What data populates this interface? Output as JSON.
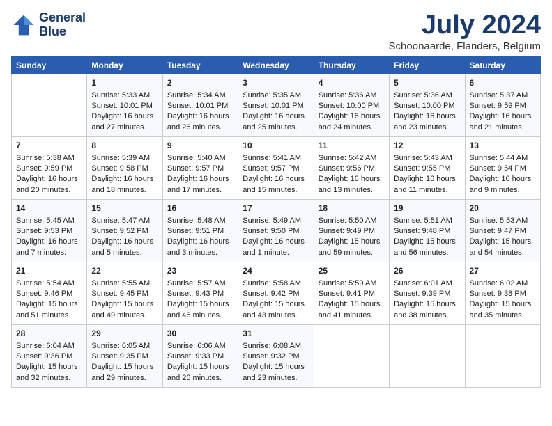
{
  "header": {
    "logo_line1": "General",
    "logo_line2": "Blue",
    "title": "July 2024",
    "location": "Schoonaarde, Flanders, Belgium"
  },
  "weekdays": [
    "Sunday",
    "Monday",
    "Tuesday",
    "Wednesday",
    "Thursday",
    "Friday",
    "Saturday"
  ],
  "weeks": [
    [
      {
        "day": "",
        "info": ""
      },
      {
        "day": "1",
        "info": "Sunrise: 5:33 AM\nSunset: 10:01 PM\nDaylight: 16 hours\nand 27 minutes."
      },
      {
        "day": "2",
        "info": "Sunrise: 5:34 AM\nSunset: 10:01 PM\nDaylight: 16 hours\nand 26 minutes."
      },
      {
        "day": "3",
        "info": "Sunrise: 5:35 AM\nSunset: 10:01 PM\nDaylight: 16 hours\nand 25 minutes."
      },
      {
        "day": "4",
        "info": "Sunrise: 5:36 AM\nSunset: 10:00 PM\nDaylight: 16 hours\nand 24 minutes."
      },
      {
        "day": "5",
        "info": "Sunrise: 5:36 AM\nSunset: 10:00 PM\nDaylight: 16 hours\nand 23 minutes."
      },
      {
        "day": "6",
        "info": "Sunrise: 5:37 AM\nSunset: 9:59 PM\nDaylight: 16 hours\nand 21 minutes."
      }
    ],
    [
      {
        "day": "7",
        "info": "Sunrise: 5:38 AM\nSunset: 9:59 PM\nDaylight: 16 hours\nand 20 minutes."
      },
      {
        "day": "8",
        "info": "Sunrise: 5:39 AM\nSunset: 9:58 PM\nDaylight: 16 hours\nand 18 minutes."
      },
      {
        "day": "9",
        "info": "Sunrise: 5:40 AM\nSunset: 9:57 PM\nDaylight: 16 hours\nand 17 minutes."
      },
      {
        "day": "10",
        "info": "Sunrise: 5:41 AM\nSunset: 9:57 PM\nDaylight: 16 hours\nand 15 minutes."
      },
      {
        "day": "11",
        "info": "Sunrise: 5:42 AM\nSunset: 9:56 PM\nDaylight: 16 hours\nand 13 minutes."
      },
      {
        "day": "12",
        "info": "Sunrise: 5:43 AM\nSunset: 9:55 PM\nDaylight: 16 hours\nand 11 minutes."
      },
      {
        "day": "13",
        "info": "Sunrise: 5:44 AM\nSunset: 9:54 PM\nDaylight: 16 hours\nand 9 minutes."
      }
    ],
    [
      {
        "day": "14",
        "info": "Sunrise: 5:45 AM\nSunset: 9:53 PM\nDaylight: 16 hours\nand 7 minutes."
      },
      {
        "day": "15",
        "info": "Sunrise: 5:47 AM\nSunset: 9:52 PM\nDaylight: 16 hours\nand 5 minutes."
      },
      {
        "day": "16",
        "info": "Sunrise: 5:48 AM\nSunset: 9:51 PM\nDaylight: 16 hours\nand 3 minutes."
      },
      {
        "day": "17",
        "info": "Sunrise: 5:49 AM\nSunset: 9:50 PM\nDaylight: 16 hours\nand 1 minute."
      },
      {
        "day": "18",
        "info": "Sunrise: 5:50 AM\nSunset: 9:49 PM\nDaylight: 15 hours\nand 59 minutes."
      },
      {
        "day": "19",
        "info": "Sunrise: 5:51 AM\nSunset: 9:48 PM\nDaylight: 15 hours\nand 56 minutes."
      },
      {
        "day": "20",
        "info": "Sunrise: 5:53 AM\nSunset: 9:47 PM\nDaylight: 15 hours\nand 54 minutes."
      }
    ],
    [
      {
        "day": "21",
        "info": "Sunrise: 5:54 AM\nSunset: 9:46 PM\nDaylight: 15 hours\nand 51 minutes."
      },
      {
        "day": "22",
        "info": "Sunrise: 5:55 AM\nSunset: 9:45 PM\nDaylight: 15 hours\nand 49 minutes."
      },
      {
        "day": "23",
        "info": "Sunrise: 5:57 AM\nSunset: 9:43 PM\nDaylight: 15 hours\nand 46 minutes."
      },
      {
        "day": "24",
        "info": "Sunrise: 5:58 AM\nSunset: 9:42 PM\nDaylight: 15 hours\nand 43 minutes."
      },
      {
        "day": "25",
        "info": "Sunrise: 5:59 AM\nSunset: 9:41 PM\nDaylight: 15 hours\nand 41 minutes."
      },
      {
        "day": "26",
        "info": "Sunrise: 6:01 AM\nSunset: 9:39 PM\nDaylight: 15 hours\nand 38 minutes."
      },
      {
        "day": "27",
        "info": "Sunrise: 6:02 AM\nSunset: 9:38 PM\nDaylight: 15 hours\nand 35 minutes."
      }
    ],
    [
      {
        "day": "28",
        "info": "Sunrise: 6:04 AM\nSunset: 9:36 PM\nDaylight: 15 hours\nand 32 minutes."
      },
      {
        "day": "29",
        "info": "Sunrise: 6:05 AM\nSunset: 9:35 PM\nDaylight: 15 hours\nand 29 minutes."
      },
      {
        "day": "30",
        "info": "Sunrise: 6:06 AM\nSunset: 9:33 PM\nDaylight: 15 hours\nand 26 minutes."
      },
      {
        "day": "31",
        "info": "Sunrise: 6:08 AM\nSunset: 9:32 PM\nDaylight: 15 hours\nand 23 minutes."
      },
      {
        "day": "",
        "info": ""
      },
      {
        "day": "",
        "info": ""
      },
      {
        "day": "",
        "info": ""
      }
    ]
  ]
}
